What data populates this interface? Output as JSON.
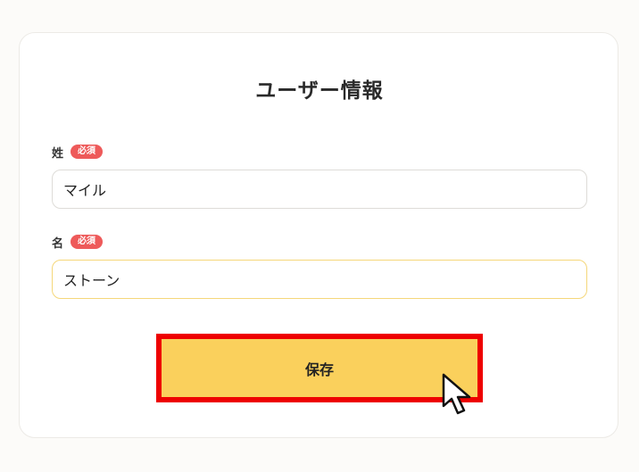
{
  "form": {
    "title": "ユーザー情報",
    "fields": [
      {
        "label": "姓",
        "badge": "必須",
        "value": "マイル",
        "state": "normal"
      },
      {
        "label": "名",
        "badge": "必須",
        "value": "ストーン",
        "state": "focused"
      }
    ],
    "save_label": "保存"
  },
  "colors": {
    "accent": "#fad05c",
    "required_badge": "#ee5a5a",
    "highlight_border": "#ee0000",
    "focus_border": "#f5d77a"
  },
  "icons": {
    "pointer": "mouse-pointer-icon"
  }
}
